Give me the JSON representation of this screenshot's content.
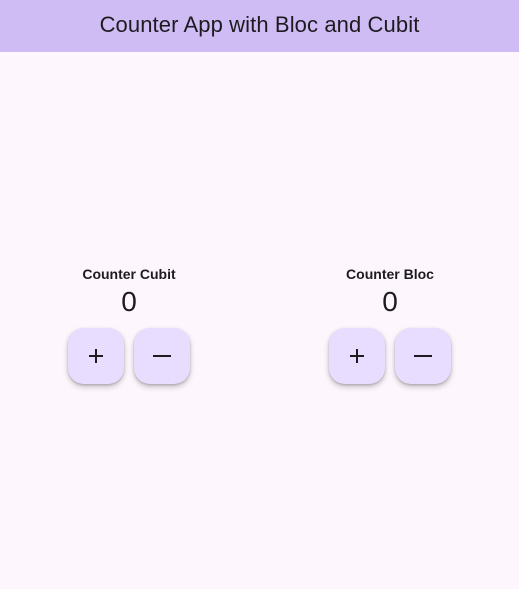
{
  "appbar": {
    "title": "Counter App with Bloc and Cubit"
  },
  "cubit": {
    "label": "Counter Cubit",
    "value": "0",
    "increment_icon": "plus-icon",
    "decrement_icon": "minus-icon"
  },
  "bloc": {
    "label": "Counter Bloc",
    "value": "0",
    "increment_icon": "plus-icon",
    "decrement_icon": "minus-icon"
  },
  "colors": {
    "appbar": "#d0bcf4",
    "background": "#fdf7fd",
    "button": "#e9ddff",
    "text": "#1d1b20"
  }
}
